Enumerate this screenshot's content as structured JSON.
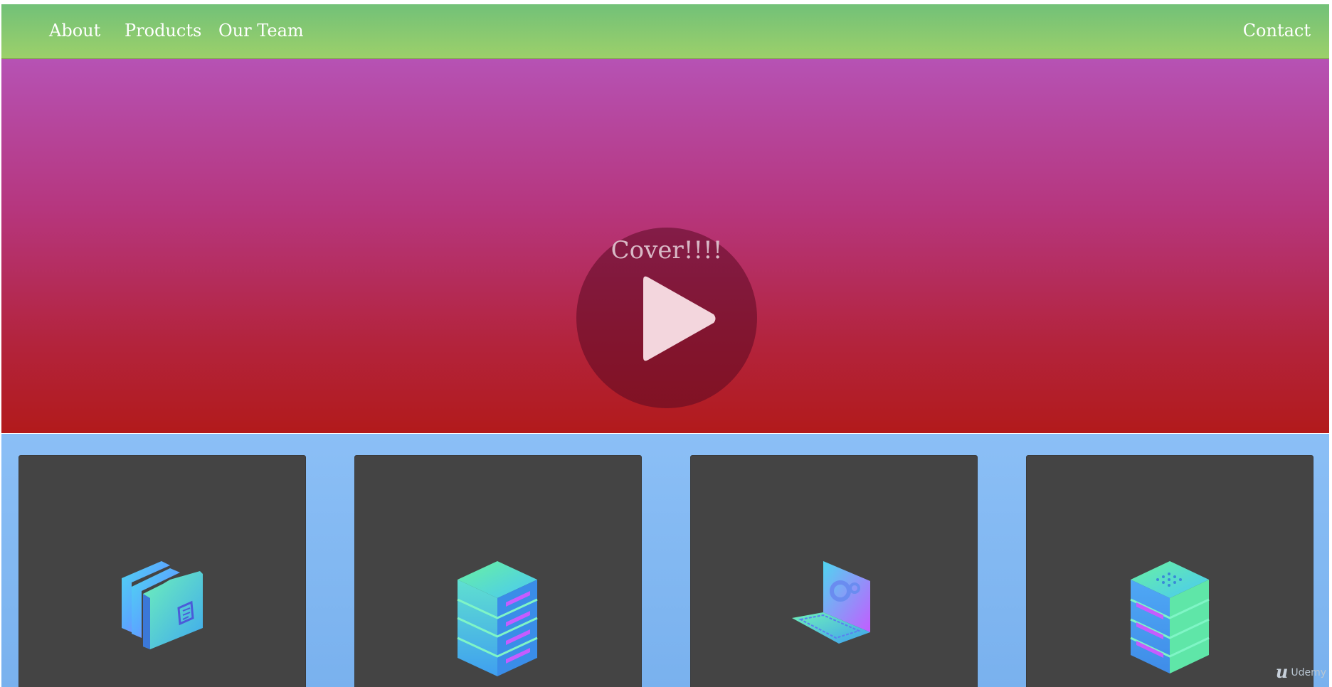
{
  "nav": {
    "links": [
      {
        "label": "About"
      },
      {
        "label": "Products"
      },
      {
        "label": "Our Team"
      }
    ],
    "contact_label": "Contact"
  },
  "hero": {
    "cover_text": "Cover!!!!"
  },
  "cards": [
    {
      "icon": "folders-icon"
    },
    {
      "icon": "server-stack-icon"
    },
    {
      "icon": "laptop-settings-icon"
    },
    {
      "icon": "database-server-icon"
    }
  ],
  "watermark": {
    "label": "Udemy"
  },
  "colors": {
    "nav_top": "#72c178",
    "nav_bottom": "#9cd06a",
    "hero_top": "#b652b4",
    "hero_bottom": "#b21a1b",
    "cards_background": "#8bbff6",
    "card_background": "#444444"
  }
}
